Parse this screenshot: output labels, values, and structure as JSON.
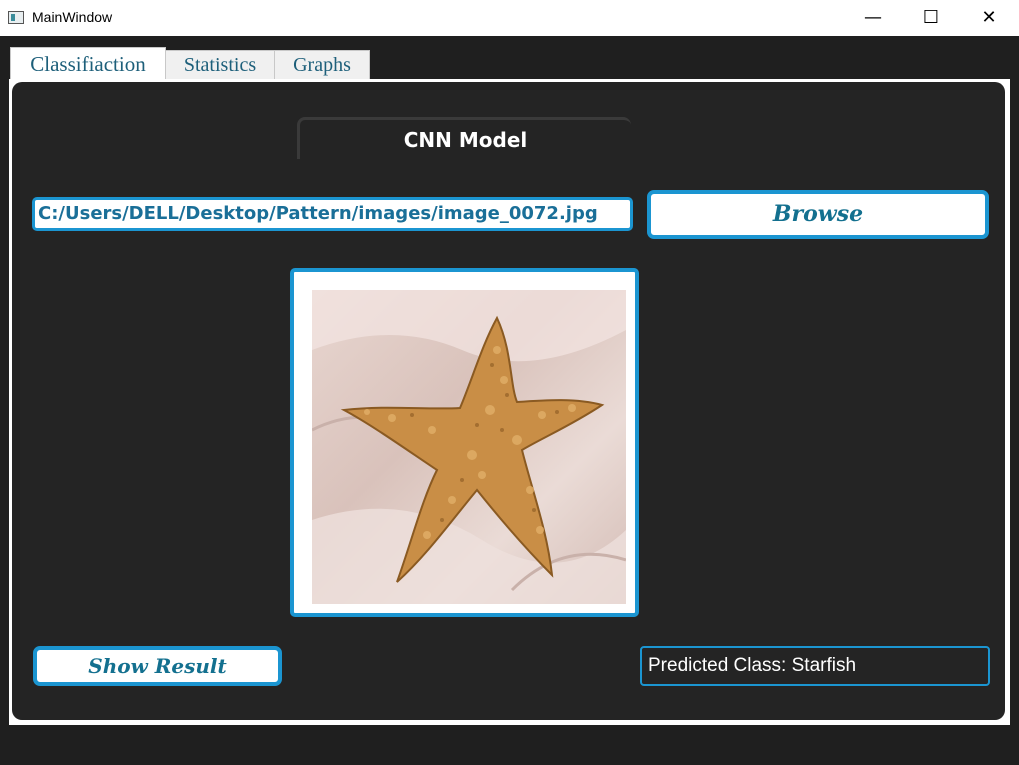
{
  "window": {
    "title": "MainWindow",
    "minimize": "—",
    "maximize": "☐",
    "close": "✕"
  },
  "tabs": [
    {
      "label": "Classifiaction",
      "active": true
    },
    {
      "label": "Statistics",
      "active": false
    },
    {
      "label": "Graphs",
      "active": false
    }
  ],
  "classification": {
    "group_title": "CNN Model",
    "path_value": "C:/Users/DELL/Desktop/Pattern/images/image_0072.jpg",
    "browse_label": "Browse",
    "show_result_label": "Show Result",
    "prediction": "Predicted Class: Starfish",
    "image_subject": "starfish"
  },
  "colors": {
    "accent": "#1b95d1",
    "button_text": "#13708f",
    "background": "#242424"
  }
}
